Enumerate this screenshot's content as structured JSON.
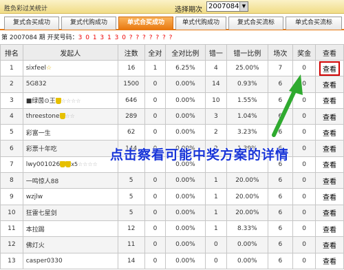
{
  "header": {
    "title": "胜负彩过关统计",
    "period_label": "选择期次",
    "period_value": "2007084"
  },
  "tabs": [
    {
      "label": "复式合买成功",
      "active": false
    },
    {
      "label": "复式代购成功",
      "active": false
    },
    {
      "label": "单式合买成功",
      "active": true
    },
    {
      "label": "单式代购成功",
      "active": false
    },
    {
      "label": "复式合买流标",
      "active": false
    },
    {
      "label": "单式合买流标",
      "active": false
    }
  ],
  "issue": {
    "prefix": "第 2007084 期 开奖号码：",
    "numbers": "3 0 1 3 1 3 0 ? ? ? ? ? ? ?"
  },
  "table": {
    "columns": [
      "排名",
      "发起人",
      "注数",
      "全对",
      "全对比例",
      "错一",
      "错一比例",
      "场次",
      "奖金",
      "查看"
    ],
    "rows": [
      {
        "rank": "1",
        "name": "sixfeel",
        "badge": "star",
        "bets": "16",
        "all": "1",
        "all_ratio": "6.25%",
        "err1": "4",
        "err1_ratio": "25.00%",
        "games": "7",
        "prize": "0",
        "view": "查看",
        "highlight": true
      },
      {
        "rank": "2",
        "name": "5G832",
        "badge": "",
        "bets": "1500",
        "all": "0",
        "all_ratio": "0.00%",
        "err1": "14",
        "err1_ratio": "0.93%",
        "games": "6",
        "prize": "0",
        "view": "查看",
        "highlight": false
      },
      {
        "rank": "3",
        "name": "■绿茵⊙王",
        "badge": "trophy-stars",
        "bets": "646",
        "all": "0",
        "all_ratio": "0.00%",
        "err1": "10",
        "err1_ratio": "1.55%",
        "games": "6",
        "prize": "0",
        "view": "查看",
        "highlight": false
      },
      {
        "rank": "4",
        "name": "threestone",
        "badge": "trophy-stars-short",
        "bets": "289",
        "all": "0",
        "all_ratio": "0.00%",
        "err1": "3",
        "err1_ratio": "1.04%",
        "games": "6",
        "prize": "0",
        "view": "查看",
        "highlight": false
      },
      {
        "rank": "5",
        "name": "彩富一生",
        "badge": "",
        "bets": "62",
        "all": "0",
        "all_ratio": "0.00%",
        "err1": "2",
        "err1_ratio": "3.23%",
        "games": "6",
        "prize": "0",
        "view": "查看",
        "highlight": false
      },
      {
        "rank": "6",
        "name": "彩票十年吃",
        "badge": "",
        "bets": "144",
        "all": "0",
        "all_ratio": "0.00%",
        "err1": "2",
        "err1_ratio": "1.39%",
        "games": "6",
        "prize": "0",
        "view": "查看",
        "highlight": false
      },
      {
        "rank": "7",
        "name": "lwy001026",
        "badge": "trophy-x5",
        "bets": "",
        "all": "",
        "all_ratio": "0.00%",
        "err1": "",
        "err1_ratio": "",
        "games": "6",
        "prize": "0",
        "view": "查看",
        "highlight": false
      },
      {
        "rank": "8",
        "name": "一鸣惊人88",
        "badge": "",
        "bets": "5",
        "all": "0",
        "all_ratio": "0.00%",
        "err1": "1",
        "err1_ratio": "20.00%",
        "games": "6",
        "prize": "0",
        "view": "查看",
        "highlight": false
      },
      {
        "rank": "9",
        "name": "wzjlw",
        "badge": "",
        "bets": "5",
        "all": "0",
        "all_ratio": "0.00%",
        "err1": "1",
        "err1_ratio": "20.00%",
        "games": "6",
        "prize": "0",
        "view": "查看",
        "highlight": false
      },
      {
        "rank": "10",
        "name": "狂雷七星剑",
        "badge": "",
        "bets": "5",
        "all": "0",
        "all_ratio": "0.00%",
        "err1": "1",
        "err1_ratio": "20.00%",
        "games": "6",
        "prize": "0",
        "view": "查看",
        "highlight": false
      },
      {
        "rank": "11",
        "name": "本拉踢",
        "badge": "",
        "bets": "12",
        "all": "0",
        "all_ratio": "0.00%",
        "err1": "1",
        "err1_ratio": "8.33%",
        "games": "6",
        "prize": "0",
        "view": "查看",
        "highlight": false
      },
      {
        "rank": "12",
        "name": "佛灯火",
        "badge": "",
        "bets": "11",
        "all": "0",
        "all_ratio": "0.00%",
        "err1": "0",
        "err1_ratio": "0.00%",
        "games": "6",
        "prize": "0",
        "view": "查看",
        "highlight": false
      },
      {
        "rank": "13",
        "name": "casper0330",
        "badge": "",
        "bets": "14",
        "all": "0",
        "all_ratio": "0.00%",
        "err1": "0",
        "err1_ratio": "0.00%",
        "games": "6",
        "prize": "0",
        "view": "查看",
        "highlight": false
      }
    ]
  },
  "annotation": {
    "text": "点击察看可能中奖方案的详情",
    "color": "#1835d8",
    "arrow_color": "#2faa2f"
  },
  "colors": {
    "tab_active": "#e87810",
    "highlight_border": "#d10000"
  }
}
